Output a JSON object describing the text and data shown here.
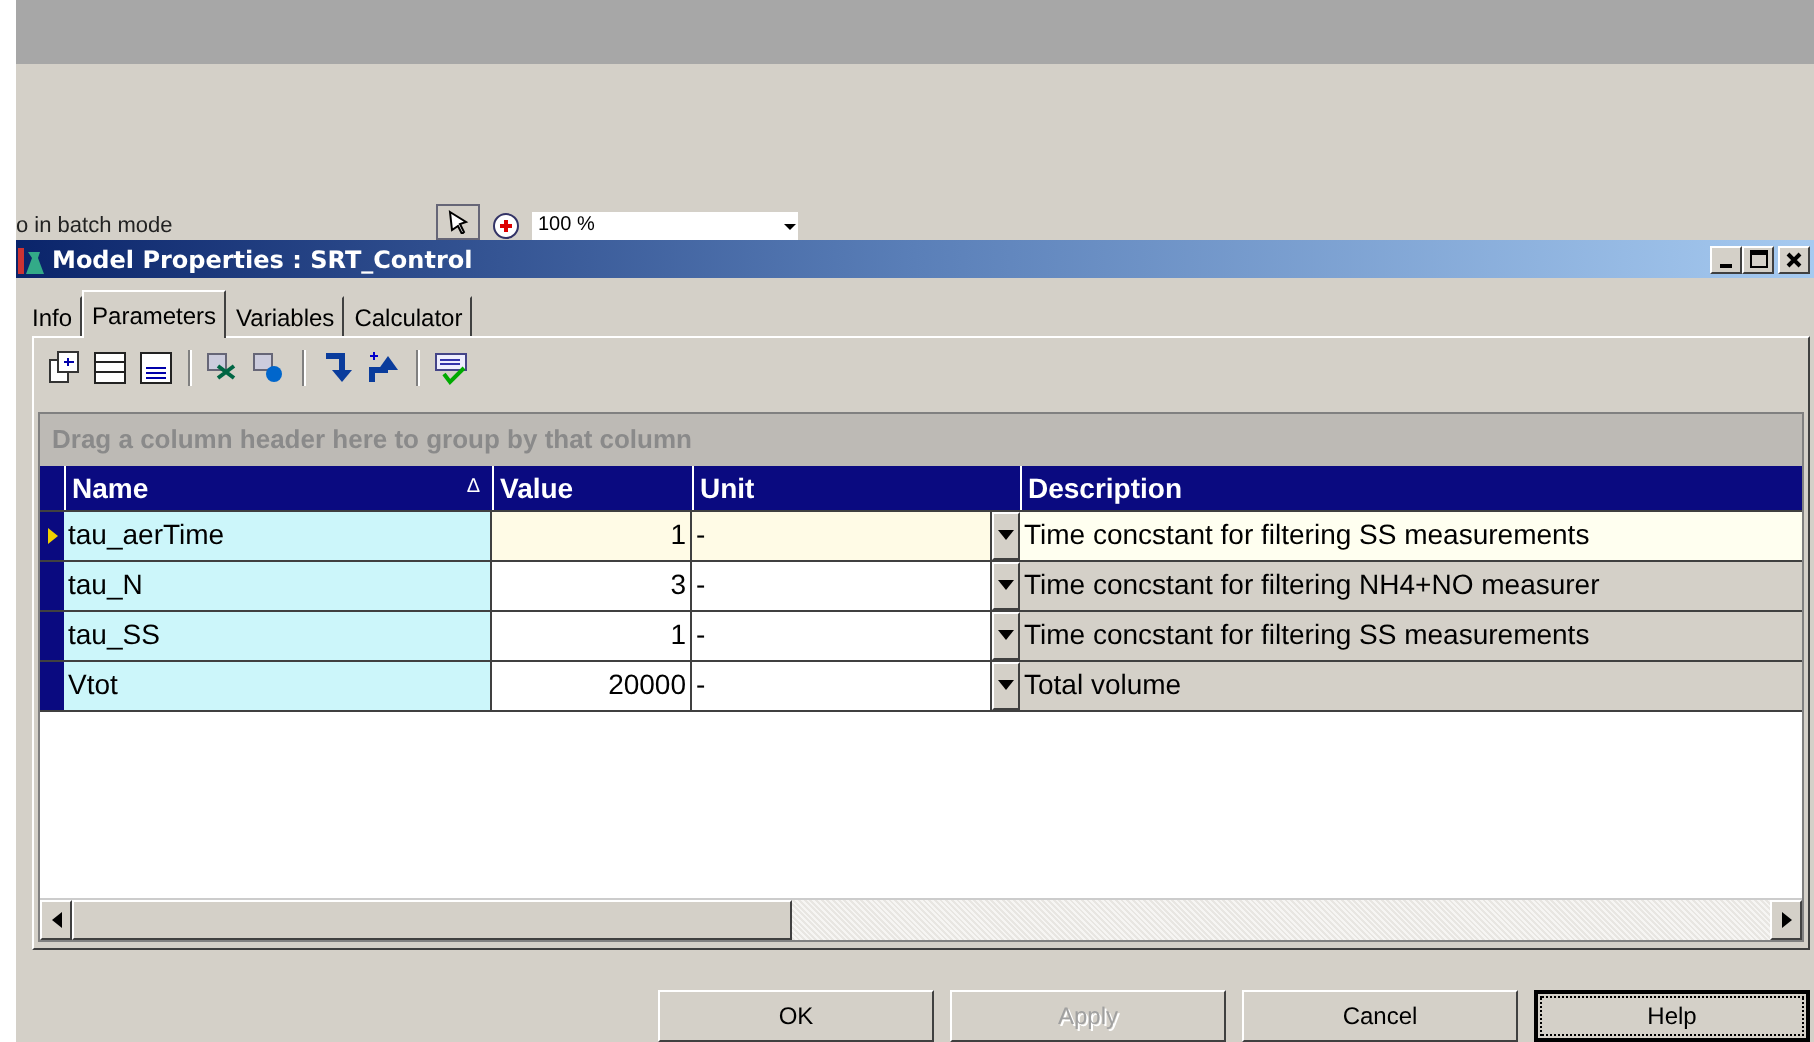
{
  "background_app": {
    "status_text": "o in batch mode",
    "zoom": "100 %"
  },
  "window": {
    "title": "Model Properties : SRT_Control"
  },
  "tabs": [
    {
      "label": "Info",
      "selected": false
    },
    {
      "label": "Parameters",
      "selected": true
    },
    {
      "label": "Variables",
      "selected": false
    },
    {
      "label": "Calculator",
      "selected": false
    }
  ],
  "group_panel": "Drag a column header here to group by that column",
  "table": {
    "columns": [
      {
        "label": "Name",
        "sort_indicator": "Δ"
      },
      {
        "label": "Value"
      },
      {
        "label": "Unit"
      },
      {
        "label": "Description"
      }
    ],
    "rows": [
      {
        "name": "tau_aerTime",
        "value": "1",
        "unit": "-",
        "description": "Time concstant for filtering SS measurements",
        "selected": true
      },
      {
        "name": "tau_N",
        "value": "3",
        "unit": "-",
        "description": "Time concstant for filtering NH4+NO measurer",
        "selected": false
      },
      {
        "name": "tau_SS",
        "value": "1",
        "unit": "-",
        "description": "Time concstant for filtering SS measurements",
        "selected": false
      },
      {
        "name": "Vtot",
        "value": "20000",
        "unit": "-",
        "description": "Total volume",
        "selected": false
      }
    ]
  },
  "buttons": [
    {
      "label": "OK",
      "disabled": false,
      "focused": false
    },
    {
      "label": "Apply",
      "disabled": true,
      "focused": false
    },
    {
      "label": "Cancel",
      "disabled": false,
      "focused": false
    },
    {
      "label": "Help",
      "disabled": false,
      "focused": true
    }
  ]
}
